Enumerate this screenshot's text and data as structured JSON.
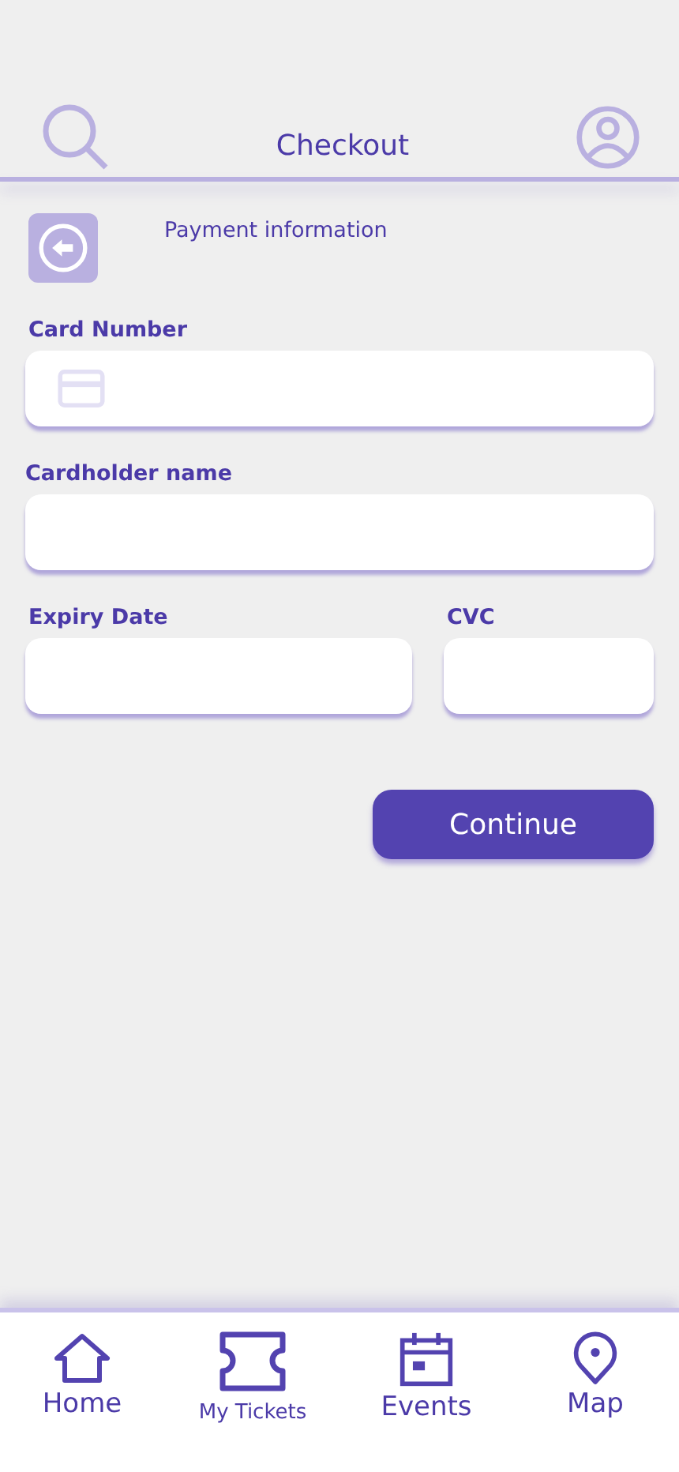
{
  "header": {
    "title": "Checkout"
  },
  "section": {
    "title": "Payment information"
  },
  "card_number": {
    "label": "Card Number"
  },
  "cardholder_name": {
    "label": "Cardholder name"
  },
  "expiry_date": {
    "label": "Expiry Date"
  },
  "cvc": {
    "label": "CVC"
  },
  "continue_button": {
    "label": "Continue"
  },
  "nav": [
    {
      "kind": "home",
      "label": "Home"
    },
    {
      "kind": "tickets",
      "label": "My Tickets"
    },
    {
      "kind": "events",
      "label": "Events"
    },
    {
      "kind": "map",
      "label": "Map"
    }
  ]
}
